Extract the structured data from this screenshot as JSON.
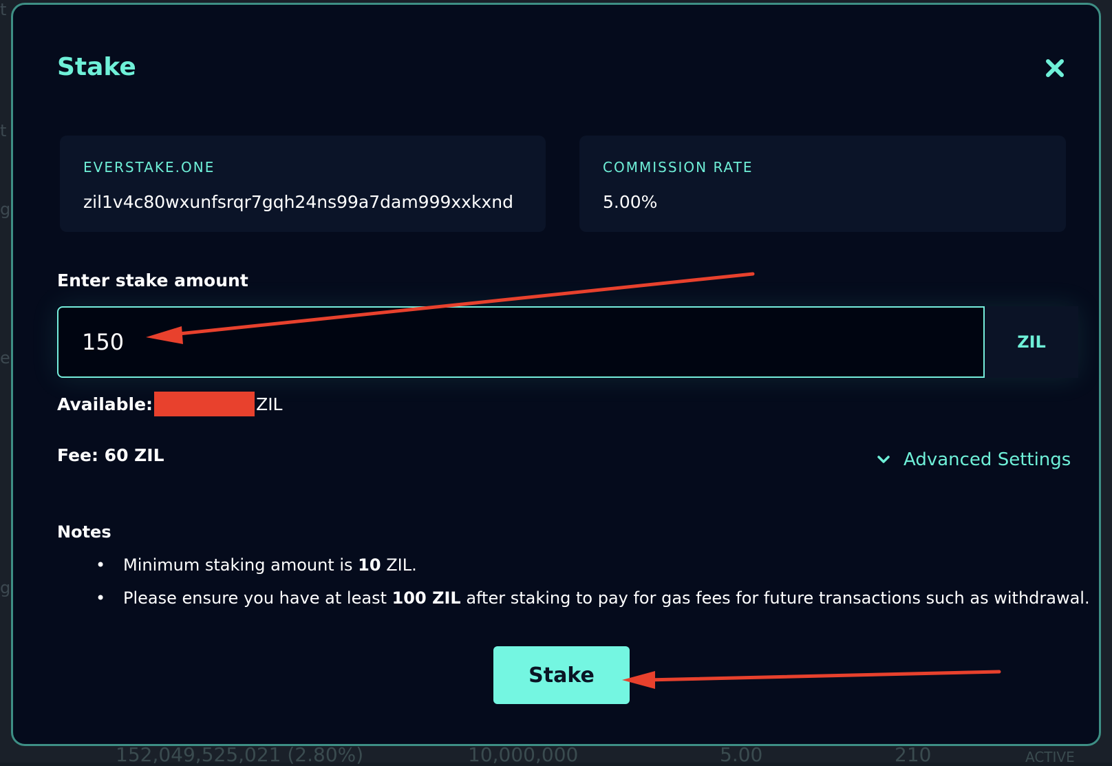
{
  "background": {
    "footer_values": [
      "152,049,525,021 (2.80%)",
      "10,000,000",
      "5.00",
      "210",
      "ACTIVE"
    ],
    "side_chars": [
      "t",
      "t",
      "g",
      "e",
      "g"
    ]
  },
  "modal": {
    "title": "Stake",
    "close_icon": "close-x-icon"
  },
  "validator": {
    "name": "EVERSTAKE.ONE",
    "address": "zil1v4c80wxunfsrqr7gqh24ns99a7dam999xxkxnd"
  },
  "commission": {
    "label": "COMMISSION RATE",
    "value": "5.00%"
  },
  "stake_input": {
    "label": "Enter stake amount",
    "value": "150",
    "unit": "ZIL"
  },
  "available": {
    "label": "Available:",
    "unit": "ZIL"
  },
  "fee": {
    "text": "Fee: 60 ZIL"
  },
  "advanced": {
    "label": "Advanced Settings",
    "icon": "chevron-down-icon"
  },
  "notes": {
    "title": "Notes",
    "item1": {
      "before": "Minimum staking amount is ",
      "bold": "10",
      "after": " ZIL."
    },
    "item2": {
      "before": "Please ensure you have at least ",
      "bold": "100 ZIL",
      "after": " after staking to pay for gas fees for future transactions such as withdrawal."
    }
  },
  "actions": {
    "stake_label": "Stake"
  },
  "colors": {
    "accent": "#6ff0d8",
    "modal_bg": "#050b1c",
    "card_bg": "#0b1428",
    "button_bg": "#74f6e1",
    "annotation_red": "#e8412d"
  }
}
